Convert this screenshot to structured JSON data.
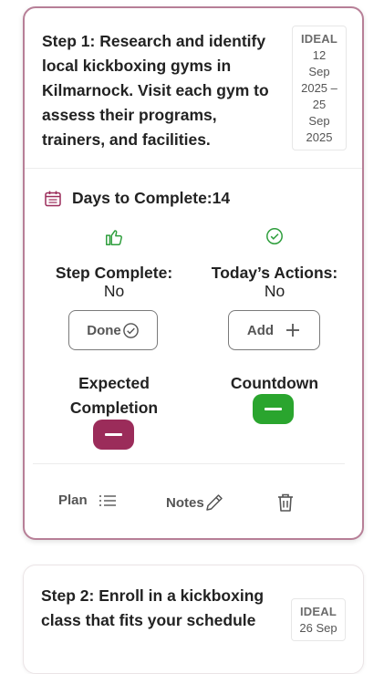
{
  "steps": [
    {
      "text": "Step 1: Research and identify local kickboxing gyms in Kilmarnock. Visit each gym to assess their programs, trainers, and facilities.",
      "date_label": "IDEAL",
      "date_lines": [
        "12",
        "Sep",
        "2025 –",
        "25",
        "Sep",
        "2025"
      ],
      "days_label": "Days to Complete:",
      "days_value": "14",
      "step_complete_label": "Step Complete:",
      "step_complete_value": "No",
      "done_label": "Done",
      "todays_actions_label": "Today’s Actions:",
      "todays_actions_value": "No",
      "add_label": "Add",
      "expected_label_1": "Expected",
      "expected_label_2": "Completion",
      "countdown_label": "Countdown",
      "plan_label": "Plan",
      "notes_label": "Notes"
    },
    {
      "text": "Step 2: Enroll in a kickboxing class that fits your schedule",
      "date_label": "IDEAL",
      "date_lines": [
        "26 Sep"
      ]
    }
  ],
  "colors": {
    "active_border": "#b77f97",
    "expected_pill": "#9b2c5a",
    "countdown_pill": "#2aa52e",
    "check_green": "#2e9e3c",
    "calendar_icon": "#9b2c5a"
  }
}
